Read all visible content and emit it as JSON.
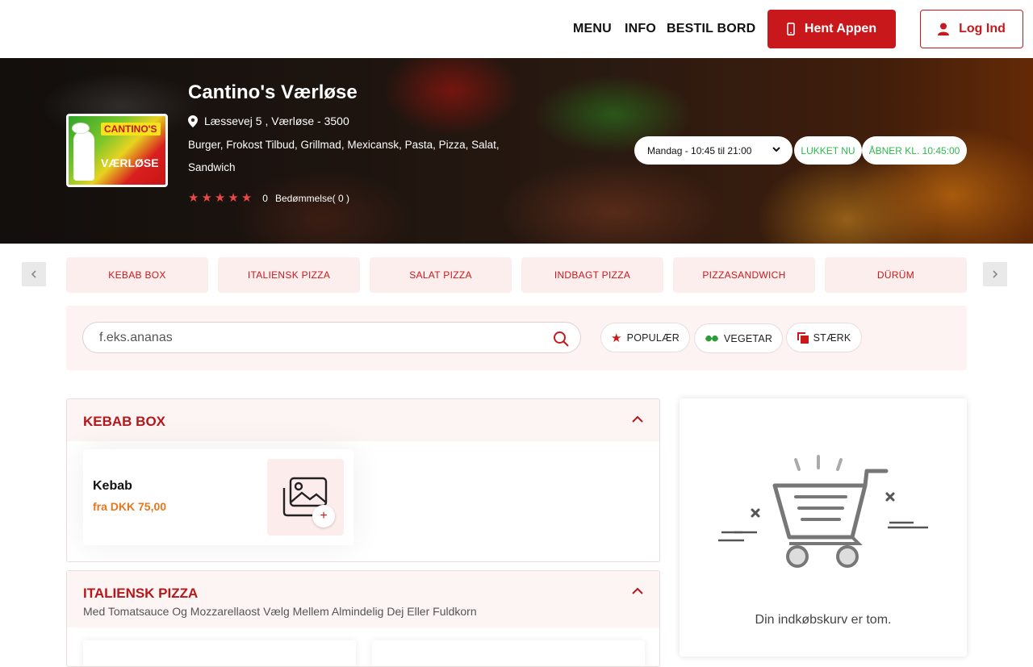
{
  "header": {
    "nav": [
      "MENU",
      "INFO",
      "BESTIL BORD"
    ],
    "get_app_label": "Hent Appen",
    "login_label": "Log Ind"
  },
  "restaurant": {
    "logo_text_top": "CANTINO'S",
    "logo_text_bottom": "VÆRLØSE",
    "name": "Cantino's Værløse",
    "address": "Læssevej 5 , Værløse - 3500",
    "cuisines": "Burger, Frokost Tilbud, Grillmad, Mexicansk, Pasta, Pizza, Salat, Sandwich",
    "rating_value": "0",
    "rating_label": "Bedømmelse( 0 )",
    "hours_selected": "Mandag - 10:45 til 21:00",
    "status_closed": "LUKKET NU",
    "status_opens": "ÅBNER KL. 10:45:00"
  },
  "categories": [
    "KEBAB BOX",
    "ITALIENSK PIZZA",
    "SALAT PIZZA",
    "INDBAGT PIZZA",
    "PIZZASANDWICH",
    "DÜRÜM"
  ],
  "search": {
    "placeholder": "f.eks.ananas"
  },
  "filters": [
    "POPULÆR",
    "VEGETAR",
    "STÆRK"
  ],
  "sections": [
    {
      "title": "KEBAB BOX",
      "items": [
        {
          "name": "Kebab",
          "price": "fra DKK 75,00"
        }
      ]
    },
    {
      "title": "ITALIENSK PIZZA",
      "description": "Med Tomatsauce Og Mozzarellaost Vælg Mellem Almindelig Dej Eller Fuldkorn"
    }
  ],
  "cart": {
    "empty_text": "Din indkøbskurv er tom."
  },
  "colors": {
    "brand_red": "#c8181b",
    "open_green": "#2db84b",
    "price_orange": "#e8761b",
    "tab_bg": "#fdeeee"
  }
}
